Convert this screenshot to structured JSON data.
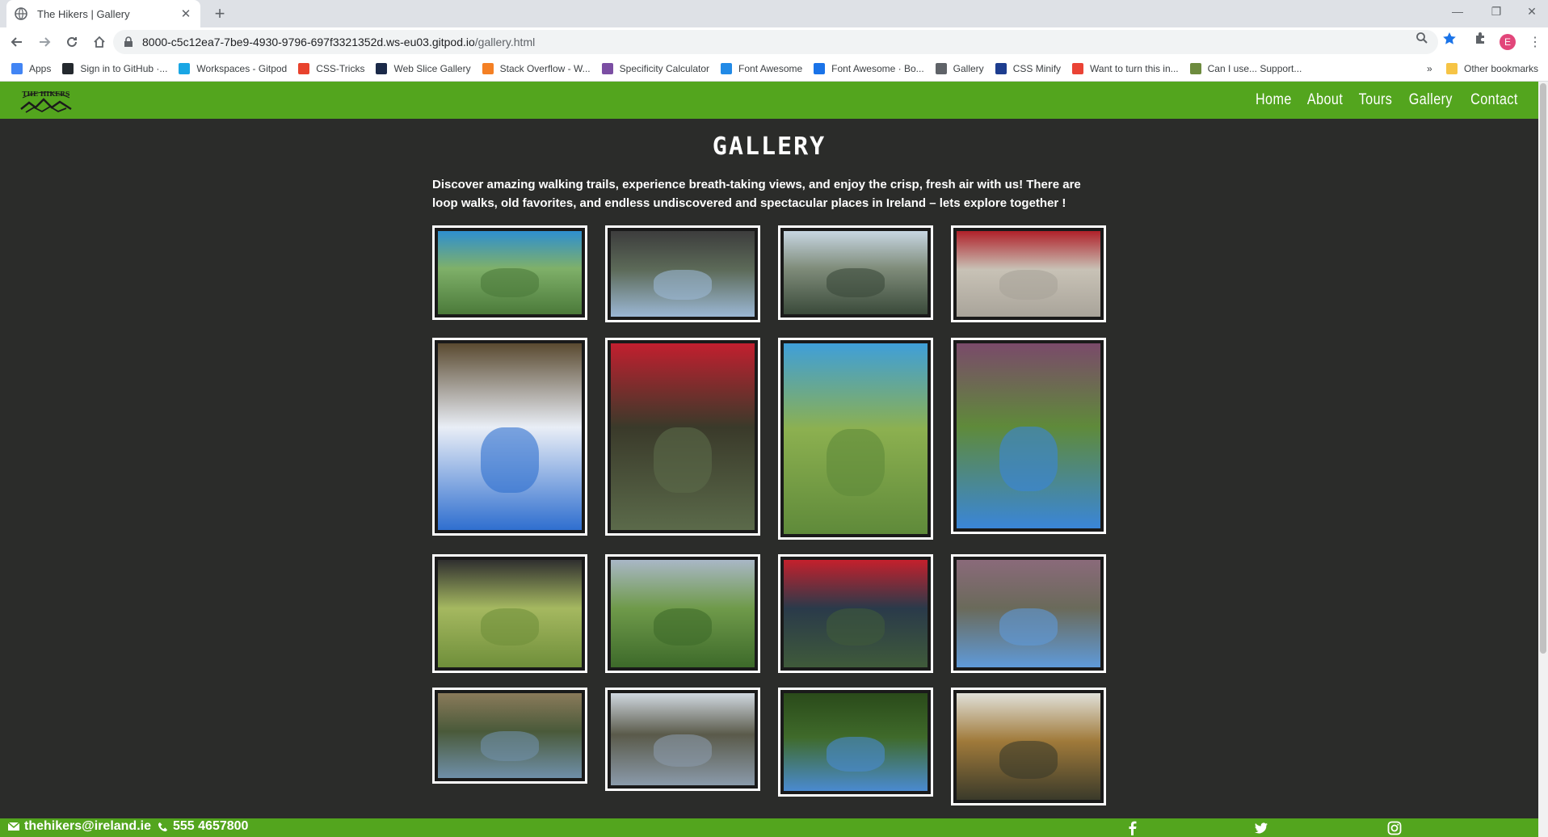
{
  "browser": {
    "tab_title": "The Hikers | Gallery",
    "url_host": "8000-c5c12ea7-7be9-4930-9796-697f3321352d.ws-eu03.gitpod.io",
    "url_path": "/gallery.html",
    "profile_initial": "E",
    "bookmarks": [
      {
        "label": "Apps",
        "icon": "apps-grid-icon",
        "color": "#4285f4"
      },
      {
        "label": "Sign in to GitHub ·...",
        "icon": "github-icon",
        "color": "#24292e"
      },
      {
        "label": "Workspaces - Gitpod",
        "icon": "gitpod-icon",
        "color": "#1aa6e4"
      },
      {
        "label": "CSS-Tricks",
        "icon": "css-tricks-icon",
        "color": "#e8432d"
      },
      {
        "label": "Web Slice Gallery",
        "icon": "web-slice-icon",
        "color": "#1b2a49"
      },
      {
        "label": "Stack Overflow - W...",
        "icon": "stackoverflow-icon",
        "color": "#f48024"
      },
      {
        "label": "Specificity Calculator",
        "icon": "specificity-icon",
        "color": "#7b4ea3"
      },
      {
        "label": "Font Awesome",
        "icon": "font-awesome-icon",
        "color": "#228ae6"
      },
      {
        "label": "Font Awesome · Bo...",
        "icon": "font-awesome-bootstrap-icon",
        "color": "#1a73e8"
      },
      {
        "label": "Gallery",
        "icon": "globe-icon",
        "color": "#5f6368"
      },
      {
        "label": "CSS Minify",
        "icon": "css-minify-icon",
        "color": "#1d3d8f"
      },
      {
        "label": "Want to turn this in...",
        "icon": "opera-icon",
        "color": "#ea4335"
      },
      {
        "label": "Can I use... Support...",
        "icon": "caniuse-icon",
        "color": "#6d8b3e"
      }
    ],
    "overflow_label": "»",
    "other_bookmarks": "Other bookmarks"
  },
  "site": {
    "nav": [
      "Home",
      "About",
      "Tours",
      "Gallery",
      "Contact"
    ],
    "logo_text": "THE HIKERS"
  },
  "main": {
    "title": "GALLERY",
    "intro": "Discover amazing walking trails, experience breath-taking views, and enjoy the crisp, fresh air with us! There are loop walks, old favorites, and endless undiscovered and spectacular places in Ireland – lets explore together !"
  },
  "gallery": [
    {
      "alt": "hikers-lying-on-mats"
    },
    {
      "alt": "group-on-summit-rocks"
    },
    {
      "alt": "hiker-by-mountain-stream"
    },
    {
      "alt": "dancers-jumping-on-beach"
    },
    {
      "alt": "dancers-under-clouds"
    },
    {
      "alt": "dancers-in-forest"
    },
    {
      "alt": "painted-blue-sheep"
    },
    {
      "alt": "dancers-on-heather-hill"
    },
    {
      "alt": "jeep-on-moorland"
    },
    {
      "alt": "forest-trail-valley"
    },
    {
      "alt": "cliff-lake-view"
    },
    {
      "alt": "hiker-on-rocky-outcrop"
    },
    {
      "alt": "group-resting-on-path"
    },
    {
      "alt": "summit-cross-group"
    },
    {
      "alt": "green-mountain-peak"
    },
    {
      "alt": "waterfall-pool"
    }
  ],
  "footer": {
    "email": "thehikers@ireland.ie",
    "phone": "555 4657800",
    "social": [
      "facebook-icon",
      "twitter-icon",
      "instagram-icon"
    ]
  }
}
